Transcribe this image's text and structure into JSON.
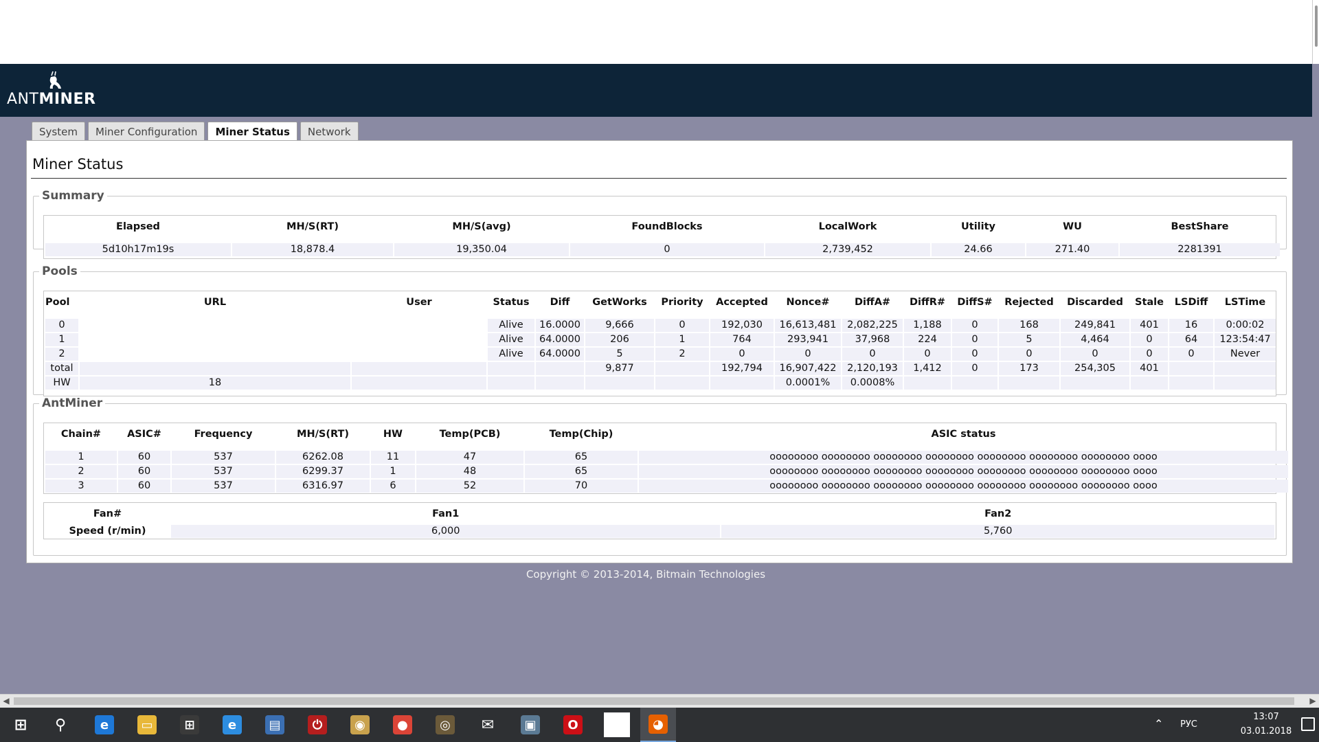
{
  "brand": {
    "prefix": "ANT",
    "suffix": "MINER"
  },
  "tabs": [
    {
      "label": "System"
    },
    {
      "label": "Miner Configuration"
    },
    {
      "label": "Miner Status"
    },
    {
      "label": "Network"
    }
  ],
  "page_title": "Miner Status",
  "summary": {
    "legend": "Summary",
    "headers": [
      "Elapsed",
      "MH/S(RT)",
      "MH/S(avg)",
      "FoundBlocks",
      "LocalWork",
      "Utility",
      "WU",
      "BestShare"
    ],
    "values": [
      "5d10h17m19s",
      "18,878.4",
      "19,350.04",
      "0",
      "2,739,452",
      "24.66",
      "271.40",
      "2281391"
    ]
  },
  "pools": {
    "legend": "Pools",
    "headers": [
      "Pool",
      "URL",
      "User",
      "Status",
      "Diff",
      "GetWorks",
      "Priority",
      "Accepted",
      "Nonce#",
      "DiffA#",
      "DiffR#",
      "DiffS#",
      "Rejected",
      "Discarded",
      "Stale",
      "LSDiff",
      "LSTime"
    ],
    "rows": [
      [
        "0",
        "",
        "",
        "Alive",
        "16.0000",
        "9,666",
        "0",
        "192,030",
        "16,613,481",
        "2,082,225",
        "1,188",
        "0",
        "168",
        "249,841",
        "401",
        "16",
        "0:00:02"
      ],
      [
        "1",
        "",
        "",
        "Alive",
        "64.0000",
        "206",
        "1",
        "764",
        "293,941",
        "37,968",
        "224",
        "0",
        "5",
        "4,464",
        "0",
        "64",
        "123:54:47"
      ],
      [
        "2",
        "",
        "",
        "Alive",
        "64.0000",
        "5",
        "2",
        "0",
        "0",
        "0",
        "0",
        "0",
        "0",
        "0",
        "0",
        "0",
        "Never"
      ],
      [
        "total",
        "",
        "",
        "",
        "",
        "9,877",
        "",
        "192,794",
        "16,907,422",
        "2,120,193",
        "1,412",
        "0",
        "173",
        "254,305",
        "401",
        "",
        ""
      ],
      [
        "HW",
        "18",
        "",
        "",
        "",
        "",
        "",
        "",
        "0.0001%",
        "0.0008%",
        "",
        "",
        "",
        "",
        "",
        "",
        ""
      ]
    ]
  },
  "antminer": {
    "legend": "AntMiner",
    "headers": [
      "Chain#",
      "ASIC#",
      "Frequency",
      "MH/S(RT)",
      "HW",
      "Temp(PCB)",
      "Temp(Chip)",
      "ASIC status"
    ],
    "rows": [
      [
        "1",
        "60",
        "537",
        "6262.08",
        "11",
        "47",
        "65",
        "oooooooo oooooooo oooooooo oooooooo oooooooo oooooooo oooooooo oooo"
      ],
      [
        "2",
        "60",
        "537",
        "6299.37",
        "1",
        "48",
        "65",
        "oooooooo oooooooo oooooooo oooooooo oooooooo oooooooo oooooooo oooo"
      ],
      [
        "3",
        "60",
        "537",
        "6316.97",
        "6",
        "52",
        "70",
        "oooooooo oooooooo oooooooo oooooooo oooooooo oooooooo oooooooo oooo"
      ]
    ],
    "fans": {
      "headers": [
        "Fan#",
        "Fan1",
        "Fan2"
      ],
      "speed_label": "Speed (r/min)",
      "speeds": [
        "6,000",
        "5,760"
      ]
    }
  },
  "footer": "Copyright © 2013-2014, Bitmain Technologies",
  "taskbar": {
    "icons": [
      "windows-start-icon",
      "search-icon",
      "edge-icon",
      "file-explorer-icon",
      "store-icon",
      "internet-explorer-icon",
      "app-icon",
      "power-app-icon",
      "app-icon-2",
      "chrome-icon",
      "app-icon-3",
      "mail-icon",
      "app-icon-4",
      "opera-icon",
      "blank-app-icon",
      "firefox-icon"
    ],
    "lang": "РУС",
    "time": "13:07",
    "date": "03.01.2018"
  }
}
